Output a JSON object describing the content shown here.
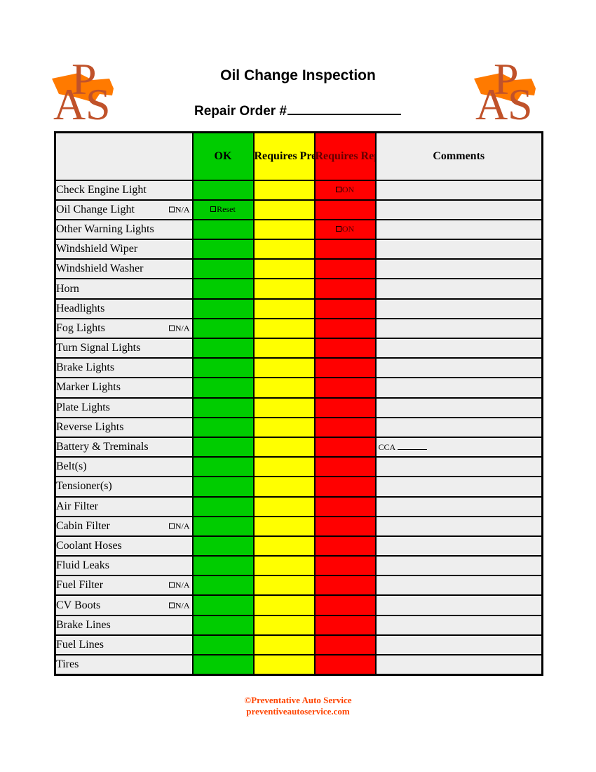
{
  "header": {
    "title": "Oil Change Inspection",
    "repair_order_label": "Repair Order #",
    "logo_text": "APS",
    "logo_colors": {
      "letters": "#c0522a",
      "car": "#ff7a00"
    }
  },
  "table": {
    "columns": [
      {
        "label": "",
        "color": "#eeeeee"
      },
      {
        "label": "OK",
        "color": "#00cc00"
      },
      {
        "label": "Requires Preventive Service",
        "color": "#ffff00"
      },
      {
        "label": "Requires Repair",
        "color": "#ff0000"
      },
      {
        "label": "Comments",
        "color": "#eeeeee"
      }
    ],
    "rows": [
      {
        "item": "Check Engine Light",
        "na": "",
        "ok": "",
        "preventive": "",
        "repair": "ON",
        "comment": ""
      },
      {
        "item": "Oil Change Light",
        "na": "N/A",
        "ok": "Reset",
        "preventive": "",
        "repair": "",
        "comment": ""
      },
      {
        "item": "Other Warning Lights",
        "na": "",
        "ok": "",
        "preventive": "",
        "repair": "ON",
        "comment": ""
      },
      {
        "item": "Windshield Wiper",
        "na": "",
        "ok": "",
        "preventive": "",
        "repair": "",
        "comment": ""
      },
      {
        "item": "Windshield Washer",
        "na": "",
        "ok": "",
        "preventive": "",
        "repair": "",
        "comment": ""
      },
      {
        "item": "Horn",
        "na": "",
        "ok": "",
        "preventive": "",
        "repair": "",
        "comment": ""
      },
      {
        "item": "Headlights",
        "na": "",
        "ok": "",
        "preventive": "",
        "repair": "",
        "comment": ""
      },
      {
        "item": "Fog Lights",
        "na": "N/A",
        "ok": "",
        "preventive": "",
        "repair": "",
        "comment": ""
      },
      {
        "item": "Turn Signal Lights",
        "na": "",
        "ok": "",
        "preventive": "",
        "repair": "",
        "comment": ""
      },
      {
        "item": "Brake Lights",
        "na": "",
        "ok": "",
        "preventive": "",
        "repair": "",
        "comment": ""
      },
      {
        "item": "Marker Lights",
        "na": "",
        "ok": "",
        "preventive": "",
        "repair": "",
        "comment": ""
      },
      {
        "item": "Plate Lights",
        "na": "",
        "ok": "",
        "preventive": "",
        "repair": "",
        "comment": ""
      },
      {
        "item": "Reverse Lights",
        "na": "",
        "ok": "",
        "preventive": "",
        "repair": "",
        "comment": ""
      },
      {
        "item": "Battery & Treminals",
        "na": "",
        "ok": "",
        "preventive": "",
        "repair": "",
        "comment": "CCA"
      },
      {
        "item": "Belt(s)",
        "na": "",
        "ok": "",
        "preventive": "",
        "repair": "",
        "comment": ""
      },
      {
        "item": "Tensioner(s)",
        "na": "",
        "ok": "",
        "preventive": "",
        "repair": "",
        "comment": ""
      },
      {
        "item": "Air Filter",
        "na": "",
        "ok": "",
        "preventive": "",
        "repair": "",
        "comment": ""
      },
      {
        "item": "Cabin Filter",
        "na": "N/A",
        "ok": "",
        "preventive": "",
        "repair": "",
        "comment": ""
      },
      {
        "item": "Coolant Hoses",
        "na": "",
        "ok": "",
        "preventive": "",
        "repair": "",
        "comment": ""
      },
      {
        "item": "Fluid Leaks",
        "na": "",
        "ok": "",
        "preventive": "",
        "repair": "",
        "comment": ""
      },
      {
        "item": "Fuel Filter",
        "na": "N/A",
        "ok": "",
        "preventive": "",
        "repair": "",
        "comment": ""
      },
      {
        "item": "CV Boots",
        "na": "N/A",
        "ok": "",
        "preventive": "",
        "repair": "",
        "comment": ""
      },
      {
        "item": "Brake Lines",
        "na": "",
        "ok": "",
        "preventive": "",
        "repair": "",
        "comment": ""
      },
      {
        "item": "Fuel Lines",
        "na": "",
        "ok": "",
        "preventive": "",
        "repair": "",
        "comment": ""
      },
      {
        "item": "Tires",
        "na": "",
        "ok": "",
        "preventive": "",
        "repair": "",
        "comment": ""
      }
    ]
  },
  "footer": {
    "copyright": "©Preventative Auto Service",
    "website": "preventiveautoservice.com",
    "color": "#ff4400"
  }
}
